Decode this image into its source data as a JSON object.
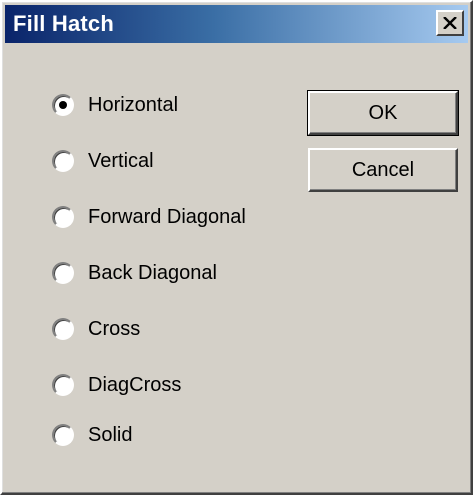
{
  "window": {
    "title": "Fill Hatch",
    "close_glyph": "X"
  },
  "options": [
    {
      "label": "Horizontal",
      "selected": true
    },
    {
      "label": "Vertical",
      "selected": false
    },
    {
      "label": "Forward Diagonal",
      "selected": false
    },
    {
      "label": "Back Diagonal",
      "selected": false
    },
    {
      "label": "Cross",
      "selected": false
    },
    {
      "label": "DiagCross",
      "selected": false
    },
    {
      "label": "Solid",
      "selected": false
    }
  ],
  "buttons": {
    "ok_label": "OK",
    "cancel_label": "Cancel"
  },
  "colors": {
    "face": "#d4d0c8",
    "title_gradient_start": "#0a246a",
    "title_gradient_end": "#a6caf0"
  }
}
